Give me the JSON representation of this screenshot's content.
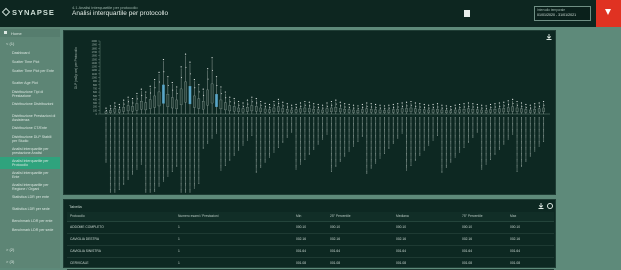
{
  "header": {
    "brand": "SYNAPSE",
    "breadcrumb": "4.1 Analisi interquartile per protocollo",
    "title": "Analisi interquartile per protocollo",
    "date_label": "Intervallo temporale",
    "date_value": "01/01/2020 - 31/01/2021",
    "filter_icon": "filter-icon",
    "save_icon": "save-icon"
  },
  "sidebar": {
    "home": "Home",
    "group_open": "< (1)",
    "items": [
      "Dashboard",
      "Scatter Time Plot",
      "Scatter Time Plot per Ente",
      "Scatter Age Plot",
      "Distribuzione Tipi di Prestazione",
      "Distribuzione Distribuzioni",
      "Distribuzione Prestazioni di Assistenza",
      "Distribuzione CT/Ente",
      "Distribuzione DLP Stabili per Studio",
      "Analisi interquartile per prestazione Analisi",
      "Analisi interquartile per Protocollo",
      "Analisi interquartile per Ente",
      "Analisi interquartile per Regione / Organi",
      "Statistica LDR per ente",
      "Statistica LDR per sede",
      "Benchmark LDR per ente",
      "Benchmark LDR per sede"
    ],
    "active_index": 10,
    "group2": "> (2)",
    "group3": "> (3)"
  },
  "chart_panel": {
    "ylabel": "DLP (mGy·cm) per Protocollo",
    "download_icon": "download-icon"
  },
  "chart_data": {
    "type": "scatter",
    "title": "",
    "ylabel": "DLP (mGy·cm) per Protocollo",
    "ylim": [
      0,
      2000
    ],
    "yticks": [
      0,
      100,
      200,
      300,
      400,
      500,
      600,
      700,
      800,
      900,
      1000,
      1100,
      1200,
      1300,
      1400,
      1500,
      1600,
      1700,
      1800,
      1900,
      2000
    ],
    "grid": false,
    "legend": "none",
    "colors": {
      "box": "#5aa7c9",
      "whisker": "#cfd8d4",
      "points": "#e7ecea",
      "label_text": "#b8c6c0"
    },
    "series": [
      {
        "name": "",
        "values": [
          120,
          180,
          260,
          220,
          340,
          420,
          380,
          520,
          640,
          560,
          720,
          900,
          1100,
          1450,
          980,
          820,
          700,
          1250,
          1600,
          1380,
          900,
          760,
          640,
          1200,
          1500,
          980,
          700,
          560,
          420,
          380,
          300,
          260,
          340,
          420,
          380,
          300,
          250,
          220,
          300,
          360,
          280,
          240,
          200,
          220,
          260,
          300,
          280,
          240,
          220,
          200,
          260,
          300,
          340,
          280,
          240,
          220,
          200,
          180,
          220,
          260,
          240,
          220,
          200,
          180,
          200,
          220,
          240,
          260,
          280,
          300,
          260,
          240,
          220,
          200,
          220,
          240,
          200,
          180,
          160,
          200,
          220,
          240,
          260,
          240,
          220,
          200,
          180,
          220,
          240,
          260,
          280,
          320,
          360,
          300,
          260,
          220,
          200,
          240,
          260,
          300
        ]
      }
    ]
  },
  "table": {
    "title": "Tabella",
    "download_icon": "download-icon",
    "settings_icon": "gear-icon",
    "columns": [
      "Protocollo",
      "Numero esami / Prestazioni",
      "Min",
      "25° Percentile",
      "Mediana",
      "75° Percentile",
      "Max"
    ],
    "rows": [
      [
        "ADDOME COMPLETO",
        "1",
        "000.10",
        "000.10",
        "000.10",
        "000.10",
        "000.10"
      ],
      [
        "CAVIGLIA DESTRA",
        "1",
        "002.16",
        "002.16",
        "002.16",
        "002.16",
        "002.16"
      ],
      [
        "CAVIGLIA SINISTRA",
        "1",
        "001.64",
        "001.64",
        "001.64",
        "001.64",
        "001.64"
      ],
      [
        "CERVICALE",
        "1",
        "001.08",
        "001.08",
        "001.08",
        "001.08",
        "001.08"
      ]
    ]
  }
}
